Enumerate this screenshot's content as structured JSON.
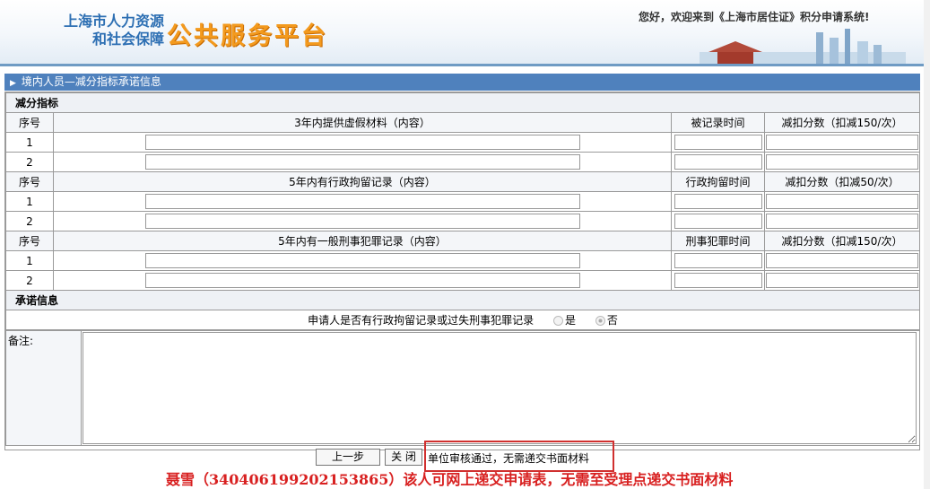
{
  "header": {
    "logo_line1": "上海市人力资源",
    "logo_line2": "和社会保障",
    "logo_main": "公共服务平台",
    "welcome": "您好，欢迎来到《上海市居住证》积分申请系统!"
  },
  "section_title": "境内人员—减分指标承诺信息",
  "deduction": {
    "heading": "减分指标",
    "col_seq": "序号",
    "groups": [
      {
        "content_header": "3年内提供虚假材料（内容）",
        "time_header": "被记录时间",
        "score_header": "减扣分数（扣减150/次）",
        "rows": [
          "1",
          "2"
        ]
      },
      {
        "content_header": "5年内有行政拘留记录（内容）",
        "time_header": "行政拘留时间",
        "score_header": "减扣分数（扣减50/次）",
        "rows": [
          "1",
          "2"
        ]
      },
      {
        "content_header": "5年内有一般刑事犯罪记录（内容）",
        "time_header": "刑事犯罪时间",
        "score_header": "减扣分数（扣减150/次）",
        "rows": [
          "1",
          "2"
        ]
      }
    ]
  },
  "commitment": {
    "heading": "承诺信息",
    "question": "申请人是否有行政拘留记录或过失刑事犯罪记录",
    "option_yes": "是",
    "option_no": "否",
    "selected": "否"
  },
  "remark_label": "备注:",
  "buttons": {
    "prev": "上一步",
    "close": "关 闭"
  },
  "status": "单位审核通过，无需递交书面材料",
  "notice": "聂雪（340406199202153865）该人可网上递交申请表，无需至受理点递交书面材料",
  "colors": {
    "section_bar": "#4f81bd",
    "notice": "#d82020",
    "highlight_box": "#d0302f",
    "logo_main": "#f39a1e",
    "logo_sub": "#2d6fb3"
  }
}
